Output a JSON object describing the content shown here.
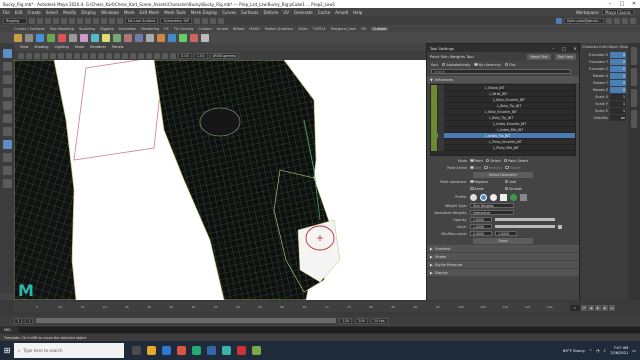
{
  "window": {
    "title": "Bucky_Rig.mb* - Autodesk Maya 2020.4: G:\\Chess_Kart\\Chess_Kart_Scene_Assets\\Character\\Bucky\\Bucky_Rig.mb* --- Prop_Lzd_Lzw:Bucky_Rig:pCube1 ... Prop2_Low1",
    "controls": [
      "–",
      "□",
      "✕"
    ]
  },
  "menus": [
    "File",
    "Edit",
    "Create",
    "Select",
    "Modify",
    "Display",
    "Windows",
    "Mesh",
    "Edit Mesh",
    "Mesh Tools",
    "Mesh Display",
    "Curves",
    "Surfaces",
    "Deform",
    "UV",
    "Generate",
    "Cache",
    "Arnold",
    "Help"
  ],
  "status": {
    "mode": "Rigging",
    "no_live_surface": "No Live Surface",
    "symmetry": "Symmetry: Off",
    "workspace_label": "Workspace:",
    "workspace_value": "Maya Classic",
    "signin": "Kylie prob@gmail..."
  },
  "shelf_tabs": [
    "Curves / Surfaces",
    "Poly Modeling",
    "Sculpting",
    "Rigging",
    "Animation",
    "Rendering",
    "FX",
    "FX Caching",
    "Custom",
    "Arnold",
    "Bifrost",
    "MASH",
    "Motion Graphics",
    "XGen",
    "TURTLE",
    "Polygons_User",
    "VR",
    "Custom"
  ],
  "panel_menu": [
    "View",
    "Shading",
    "Lighting",
    "Show",
    "Renderer",
    "Panels"
  ],
  "panel_fields": {
    "exposure": "0.00",
    "gamma": "1.00",
    "colorspace": "sRGB gamma"
  },
  "tool_settings": {
    "window_title": "Tool Settings",
    "tool_name": "Paint Skin Weights Tool",
    "reset_label": "Reset Tool",
    "help_label": "Tool Help",
    "sort_label": "Sort",
    "sort_options": [
      "Alphabetically",
      "By Hierarchy",
      "Flat"
    ],
    "search_placeholder": "Search",
    "section_influences": "Influences",
    "influences": [
      {
        "name": "L_Elbow_JNT",
        "selected": false
      },
      {
        "name": "L_Wrist_JNT",
        "selected": false
      },
      {
        "name": "L_Bcky_Knuckle_JNT",
        "selected": false
      },
      {
        "name": "L_Bcky_Tip_JNT",
        "selected": false
      },
      {
        "name": "L_Bcky_Knuckle_JNT",
        "selected": false
      },
      {
        "name": "L_Bcky_Tip_JNT",
        "selected": false
      },
      {
        "name": "L_Index_Knuckle_JNT",
        "selected": false
      },
      {
        "name": "L_Index_Mid_JNT",
        "selected": false
      },
      {
        "name": "L_Index_Tip_JNT",
        "selected": true
      },
      {
        "name": "L_Pinky_Knuckle_JNT",
        "selected": false
      },
      {
        "name": "L_Pinky_Mid_JNT",
        "selected": false
      }
    ],
    "mode_label": "Mode",
    "mode_options": [
      "Paint",
      "Select",
      "Paint Select"
    ],
    "paint_select_label": "Paint Select",
    "paint_select_options": [
      "Add",
      "Remove",
      "Toggle"
    ],
    "select_geometry": "Select Geometry",
    "paint_operation_label": "Paint operation:",
    "paint_operations": [
      "Replace",
      "Add",
      "Scale",
      "Smooth"
    ],
    "profile_label": "Profile:",
    "weight_type_label": "Weight Type:",
    "weight_type_value": "Skin Weights",
    "normalize_label": "Normalize Weights:",
    "normalize_value": "Interactive",
    "opacity_label": "Opacity:",
    "opacity_value": "1.0000",
    "opacity_level": 1.0,
    "value_label": "Value:",
    "value_value": "1.0000",
    "value_level": 1.0,
    "minmax_label": "Min/Max value:",
    "min_value": "0.0000",
    "max_value": "1.0000",
    "flood_label": "Flood",
    "sections_collapsed": [
      "Gradient",
      "Stroke",
      "Stylus Pressure",
      "Display"
    ]
  },
  "channel_box": {
    "header": "Channels  Edit  Object  Show",
    "rows": [
      {
        "label": "Translate X",
        "value": "0",
        "keyed": true
      },
      {
        "label": "Translate Y",
        "value": "0",
        "keyed": true
      },
      {
        "label": "Translate Z",
        "value": "0",
        "keyed": true
      },
      {
        "label": "Rotate X",
        "value": "0",
        "keyed": true
      },
      {
        "label": "Rotate Y",
        "value": "0",
        "keyed": true
      },
      {
        "label": "Rotate Z",
        "value": "0",
        "keyed": true
      },
      {
        "label": "Scale X",
        "value": "1",
        "keyed": false
      },
      {
        "label": "Scale Y",
        "value": "1",
        "keyed": false
      },
      {
        "label": "Scale Z",
        "value": "1",
        "keyed": false
      },
      {
        "label": "Visibility",
        "value": "on",
        "keyed": false
      }
    ]
  },
  "timeline": {
    "ticks": [
      "5",
      "10",
      "15",
      "20",
      "25",
      "30",
      "35",
      "40",
      "45",
      "50",
      "55",
      "60",
      "65",
      "70",
      "75",
      "80",
      "85",
      "90",
      "95",
      "100",
      "105",
      "110",
      "115",
      "120"
    ],
    "current_frame": "1",
    "range_start": "1",
    "range_end": "120",
    "anim_end": "200",
    "fps": "24 fps"
  },
  "mel": {
    "label": "MEL"
  },
  "help_line": "Translate: Ctrl+LMB to move the selected object",
  "taskbar": {
    "search_placeholder": "Type here to search",
    "weather": "69°F  Sunny",
    "time": "7:07 AM",
    "date": "7/26/2021"
  },
  "colors": {
    "accent": "#4c7bb4",
    "influence_check": "#6c8a2f",
    "viewport_bg": "#ffffff"
  }
}
